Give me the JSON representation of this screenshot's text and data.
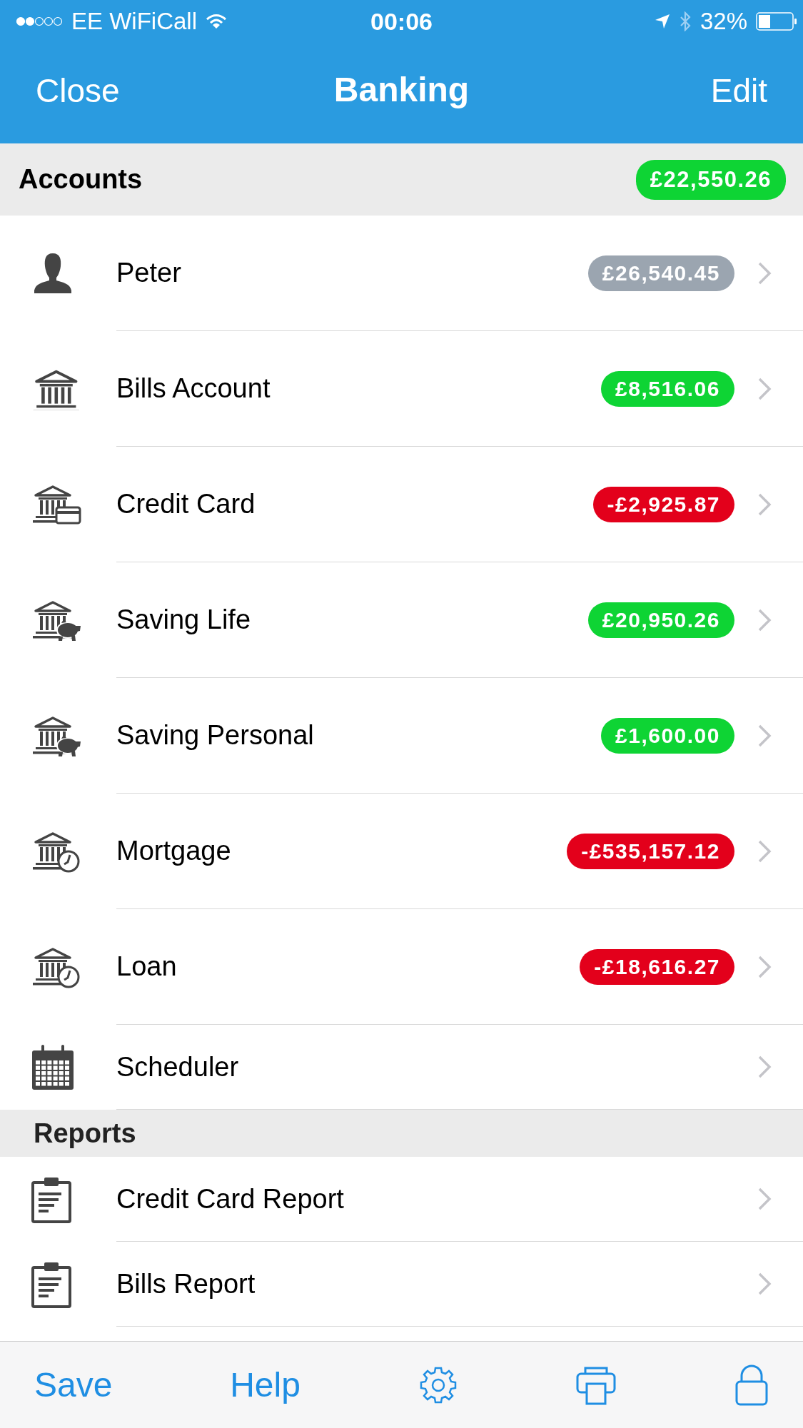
{
  "status_bar": {
    "carrier": "EE WiFiCall",
    "time": "00:06",
    "battery": "32%"
  },
  "nav_bar": {
    "left": "Close",
    "title": "Banking",
    "right": "Edit"
  },
  "sections": [
    {
      "title": "Accounts",
      "total": {
        "amount": "£22,550.26",
        "color": "#0ed434"
      },
      "items": [
        {
          "kind": "person",
          "label": "Peter",
          "badge": {
            "amount": "£26,540.45",
            "color": "#9ba5b0"
          }
        },
        {
          "kind": "bank",
          "label": "Bills Account",
          "badge": {
            "amount": "£8,516.06",
            "color": "#0ed434"
          }
        },
        {
          "kind": "card",
          "label": "Credit Card",
          "badge": {
            "amount": "-£2,925.87",
            "color": "#e3001b"
          }
        },
        {
          "kind": "piggy",
          "label": "Saving Life",
          "badge": {
            "amount": "£20,950.26",
            "color": "#0ed434"
          }
        },
        {
          "kind": "piggy",
          "label": "Saving Personal",
          "badge": {
            "amount": "£1,600.00",
            "color": "#0ed434"
          }
        },
        {
          "kind": "clock",
          "label": "Mortgage",
          "badge": {
            "amount": "-£535,157.12",
            "color": "#e3001b"
          }
        },
        {
          "kind": "clock",
          "label": "Loan",
          "badge": {
            "amount": "-£18,616.27",
            "color": "#e3001b"
          }
        },
        {
          "kind": "calendar",
          "label": "Scheduler"
        }
      ]
    },
    {
      "title": "Reports",
      "items": [
        {
          "kind": "report",
          "label": "Credit Card Report"
        },
        {
          "kind": "report",
          "label": "Bills Report"
        }
      ]
    }
  ],
  "toolbar": [
    {
      "kind": "text",
      "label": "Save"
    },
    {
      "kind": "text",
      "label": "Help"
    },
    {
      "kind": "settings"
    },
    {
      "kind": "print"
    },
    {
      "kind": "lock"
    }
  ]
}
